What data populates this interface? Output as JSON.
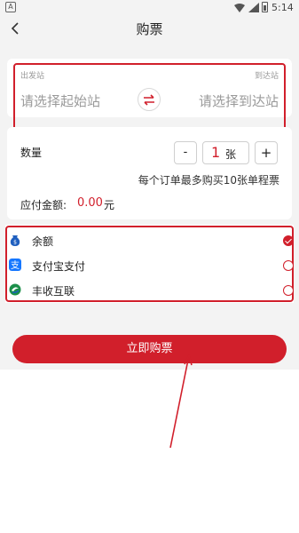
{
  "status_bar": {
    "left_icon_letter": "A",
    "time": "5:14"
  },
  "nav": {
    "title": "购票"
  },
  "stations": {
    "from_label": "出发站",
    "to_label": "到达站",
    "from_placeholder": "请选择起始站",
    "to_placeholder": "请选择到达站"
  },
  "quantity": {
    "label": "数量",
    "minus": "-",
    "value": "1",
    "unit": "张",
    "plus": "+",
    "note": "每个订单最多购买10张单程票"
  },
  "amount": {
    "label": "应付金额:",
    "value": "0.00",
    "unit": "元"
  },
  "payment": {
    "options": [
      {
        "label": "余额",
        "icon": "wallet-icon",
        "selected": true
      },
      {
        "label": "支付宝支付",
        "icon": "alipay-icon",
        "selected": false
      },
      {
        "label": "丰收互联",
        "icon": "fengshou-icon",
        "selected": false
      }
    ]
  },
  "buy_button": {
    "label": "立即购票"
  },
  "colors": {
    "accent": "#d11f2b",
    "background": "#f3f3f3",
    "card": "#ffffff",
    "alipay": "#1677ff"
  }
}
